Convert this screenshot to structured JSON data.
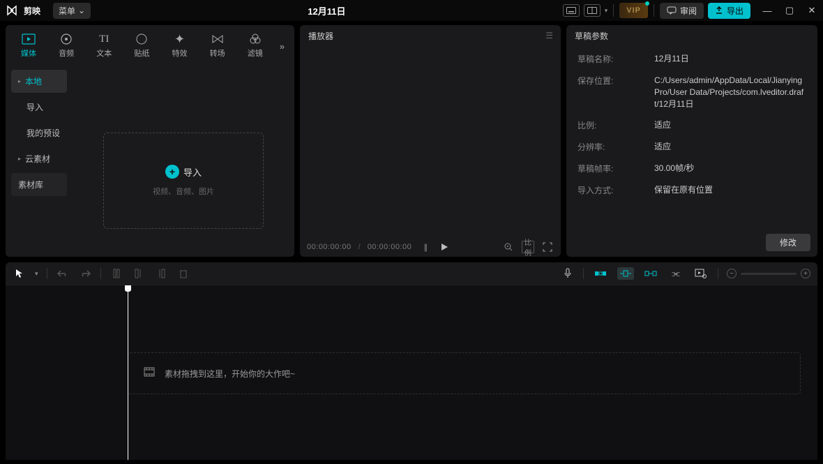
{
  "titlebar": {
    "app_name": "剪映",
    "menu_label": "菜单",
    "title": "12月11日",
    "vip_label": "VIP",
    "review_label": "审阅",
    "export_label": "导出"
  },
  "tool_tabs": [
    {
      "label": "媒体",
      "icon": "video"
    },
    {
      "label": "音频",
      "icon": "audio"
    },
    {
      "label": "文本",
      "icon": "text"
    },
    {
      "label": "贴纸",
      "icon": "sticker"
    },
    {
      "label": "特效",
      "icon": "effect"
    },
    {
      "label": "转场",
      "icon": "transition"
    },
    {
      "label": "滤镜",
      "icon": "filter"
    }
  ],
  "sidebar": {
    "items": [
      {
        "label": "本地",
        "active": true,
        "dropdown": true
      },
      {
        "label": "导入",
        "indent": true
      },
      {
        "label": "我的预设",
        "indent": true
      },
      {
        "label": "云素材",
        "dropdown": true
      },
      {
        "label": "素材库"
      }
    ]
  },
  "import": {
    "button_label": "导入",
    "hint": "视频、音频、图片"
  },
  "player": {
    "header": "播放器",
    "time_current": "00:00:00:00",
    "time_total": "00:00:00:00",
    "ratio_label": "比例"
  },
  "params": {
    "header": "草稿参数",
    "rows": [
      {
        "label": "草稿名称:",
        "value": "12月11日"
      },
      {
        "label": "保存位置:",
        "value": "C:/Users/admin/AppData/Local/JianyingPro/User Data/Projects/com.lveditor.draft/12月11日"
      },
      {
        "label": "比例:",
        "value": "适应"
      },
      {
        "label": "分辨率:",
        "value": "适应"
      },
      {
        "label": "草稿帧率:",
        "value": "30.00帧/秒"
      },
      {
        "label": "导入方式:",
        "value": "保留在原有位置"
      }
    ],
    "modify_button": "修改"
  },
  "timeline": {
    "empty_track_hint": "素材拖拽到这里，开始你的大作吧~"
  }
}
